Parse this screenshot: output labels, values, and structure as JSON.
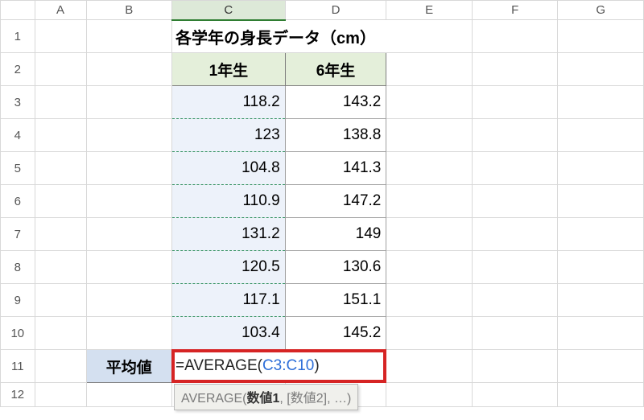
{
  "columns": [
    "A",
    "B",
    "C",
    "D",
    "E",
    "F",
    "G"
  ],
  "rows": [
    "1",
    "2",
    "3",
    "4",
    "5",
    "6",
    "7",
    "8",
    "9",
    "10",
    "11",
    "12"
  ],
  "title": "各学年の身長データ（cm）",
  "grade_headers": {
    "c": "1年生",
    "d": "6年生"
  },
  "values_c": [
    "118.2",
    "123",
    "104.8",
    "110.9",
    "131.2",
    "120.5",
    "117.1",
    "103.4"
  ],
  "values_d": [
    "143.2",
    "138.8",
    "141.3",
    "147.2",
    "149",
    "130.6",
    "151.1",
    "145.2"
  ],
  "avg_label": "平均値",
  "formula": {
    "prefix": "=",
    "fn": "AVERAGE",
    "open": "(",
    "ref": "C3:C10",
    "close": ")"
  },
  "tooltip": {
    "fn": "AVERAGE(",
    "arg1": "数値1",
    "rest": ", [数値2], …)"
  },
  "chart_data": {
    "type": "table",
    "title": "各学年の身長データ（cm）",
    "columns": [
      "1年生",
      "6年生"
    ],
    "rows": [
      [
        118.2,
        143.2
      ],
      [
        123,
        138.8
      ],
      [
        104.8,
        141.3
      ],
      [
        110.9,
        147.2
      ],
      [
        131.2,
        149
      ],
      [
        120.5,
        130.6
      ],
      [
        117.1,
        151.1
      ],
      [
        103.4,
        145.2
      ]
    ],
    "formula_cell": "C11",
    "formula": "=AVERAGE(C3:C10)"
  }
}
